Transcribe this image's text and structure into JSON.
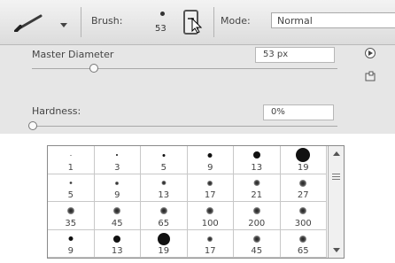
{
  "toolbar": {
    "brush_label": "Brush:",
    "brush_size": "53",
    "mode_label": "Mode:",
    "mode_value": "Normal"
  },
  "panel": {
    "master_diameter_label": "Master Diameter",
    "master_diameter_value": "53 px",
    "master_diameter_level": 0.2,
    "hardness_label": "Hardness:",
    "hardness_value": "0%",
    "hardness_level": 0.0
  },
  "presets": [
    {
      "label": "1",
      "dot": 1,
      "soft": false
    },
    {
      "label": "3",
      "dot": 2,
      "soft": false
    },
    {
      "label": "5",
      "dot": 3,
      "soft": false
    },
    {
      "label": "9",
      "dot": 5,
      "soft": false
    },
    {
      "label": "13",
      "dot": 8,
      "soft": false
    },
    {
      "label": "19",
      "dot": 16,
      "soft": false
    },
    {
      "label": "5",
      "dot": 3,
      "soft": true
    },
    {
      "label": "9",
      "dot": 4,
      "soft": true
    },
    {
      "label": "13",
      "dot": 5,
      "soft": true
    },
    {
      "label": "17",
      "dot": 6,
      "soft": true
    },
    {
      "label": "21",
      "dot": 7,
      "soft": true
    },
    {
      "label": "27",
      "dot": 8,
      "soft": true
    },
    {
      "label": "35",
      "dot": 8,
      "soft": true
    },
    {
      "label": "45",
      "dot": 8,
      "soft": true
    },
    {
      "label": "65",
      "dot": 8,
      "soft": true
    },
    {
      "label": "100",
      "dot": 8,
      "soft": true
    },
    {
      "label": "200",
      "dot": 8,
      "soft": true
    },
    {
      "label": "300",
      "dot": 8,
      "soft": true
    },
    {
      "label": "9",
      "dot": 5,
      "soft": false
    },
    {
      "label": "13",
      "dot": 8,
      "soft": false
    },
    {
      "label": "19",
      "dot": 14,
      "soft": false
    },
    {
      "label": "17",
      "dot": 6,
      "soft": true
    },
    {
      "label": "45",
      "dot": 8,
      "soft": true
    },
    {
      "label": "65",
      "dot": 8,
      "soft": true
    }
  ]
}
